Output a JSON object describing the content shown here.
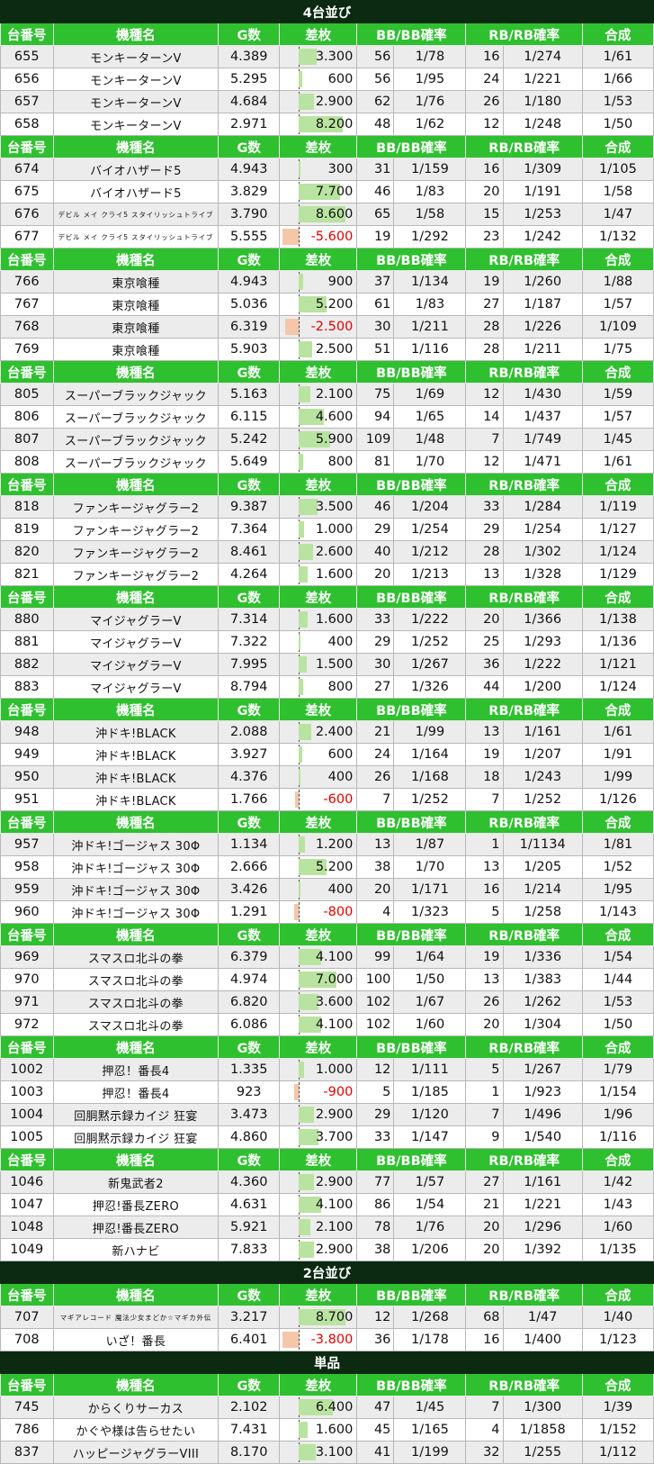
{
  "columns": [
    "台番号",
    "機種名",
    "G数",
    "差枚",
    "BB/BB確率",
    "",
    "RB/RB確率",
    "",
    "合成"
  ],
  "colors": {
    "band": "#0c2a12",
    "header": "#2fc02f",
    "plus_bar": "#b9e3a0",
    "minus_bar": "#f6c6a8",
    "minus_text": "#e00000"
  },
  "diff_scale_max": 9000,
  "blocks": [
    {
      "band": "4台並び"
    },
    {
      "rows": [
        {
          "no": "655",
          "name": "モンキーターンV",
          "g": "4.389",
          "diff": "3.300",
          "v": 3300,
          "bb": "56",
          "bbr": "1/78",
          "rb": "16",
          "rbr": "1/274",
          "total": "1/61"
        },
        {
          "no": "656",
          "name": "モンキーターンV",
          "g": "5.295",
          "diff": "600",
          "v": 600,
          "bb": "56",
          "bbr": "1/95",
          "rb": "24",
          "rbr": "1/221",
          "total": "1/66"
        },
        {
          "no": "657",
          "name": "モンキーターンV",
          "g": "4.684",
          "diff": "2.900",
          "v": 2900,
          "bb": "62",
          "bbr": "1/76",
          "rb": "26",
          "rbr": "1/180",
          "total": "1/53"
        },
        {
          "no": "658",
          "name": "モンキーターンV",
          "g": "2.971",
          "diff": "8.200",
          "v": 8200,
          "bb": "48",
          "bbr": "1/62",
          "rb": "12",
          "rbr": "1/248",
          "total": "1/50"
        }
      ]
    },
    {
      "rows": [
        {
          "no": "674",
          "name": "バイオハザード5",
          "g": "4.943",
          "diff": "300",
          "v": 300,
          "bb": "31",
          "bbr": "1/159",
          "rb": "16",
          "rbr": "1/309",
          "total": "1/105"
        },
        {
          "no": "675",
          "name": "バイオハザード5",
          "g": "3.829",
          "diff": "7.700",
          "v": 7700,
          "bb": "46",
          "bbr": "1/83",
          "rb": "20",
          "rbr": "1/191",
          "total": "1/58"
        },
        {
          "no": "676",
          "name": "デビル メイ クライ5 スタイリッシュトライブ",
          "small": true,
          "g": "3.790",
          "diff": "8.600",
          "v": 8600,
          "bb": "65",
          "bbr": "1/58",
          "rb": "15",
          "rbr": "1/253",
          "total": "1/47"
        },
        {
          "no": "677",
          "name": "デビル メイ クライ5 スタイリッシュトライブ",
          "small": true,
          "g": "5.555",
          "diff": "-5.600",
          "v": -5600,
          "bb": "19",
          "bbr": "1/292",
          "rb": "23",
          "rbr": "1/242",
          "total": "1/132"
        }
      ]
    },
    {
      "rows": [
        {
          "no": "766",
          "name": "東京喰種",
          "g": "4.943",
          "diff": "900",
          "v": 900,
          "bb": "37",
          "bbr": "1/134",
          "rb": "19",
          "rbr": "1/260",
          "total": "1/88"
        },
        {
          "no": "767",
          "name": "東京喰種",
          "g": "5.036",
          "diff": "5.200",
          "v": 5200,
          "bb": "61",
          "bbr": "1/83",
          "rb": "27",
          "rbr": "1/187",
          "total": "1/57"
        },
        {
          "no": "768",
          "name": "東京喰種",
          "g": "6.319",
          "diff": "-2.500",
          "v": -2500,
          "bb": "30",
          "bbr": "1/211",
          "rb": "28",
          "rbr": "1/226",
          "total": "1/109"
        },
        {
          "no": "769",
          "name": "東京喰種",
          "g": "5.903",
          "diff": "2.500",
          "v": 2500,
          "bb": "51",
          "bbr": "1/116",
          "rb": "28",
          "rbr": "1/211",
          "total": "1/75"
        }
      ]
    },
    {
      "rows": [
        {
          "no": "805",
          "name": "スーパーブラックジャック",
          "g": "5.163",
          "diff": "2.100",
          "v": 2100,
          "bb": "75",
          "bbr": "1/69",
          "rb": "12",
          "rbr": "1/430",
          "total": "1/59"
        },
        {
          "no": "806",
          "name": "スーパーブラックジャック",
          "g": "6.115",
          "diff": "4.600",
          "v": 4600,
          "bb": "94",
          "bbr": "1/65",
          "rb": "14",
          "rbr": "1/437",
          "total": "1/57"
        },
        {
          "no": "807",
          "name": "スーパーブラックジャック",
          "g": "5.242",
          "diff": "5.900",
          "v": 5900,
          "bb": "109",
          "bbr": "1/48",
          "rb": "7",
          "rbr": "1/749",
          "total": "1/45"
        },
        {
          "no": "808",
          "name": "スーパーブラックジャック",
          "g": "5.649",
          "diff": "800",
          "v": 800,
          "bb": "81",
          "bbr": "1/70",
          "rb": "12",
          "rbr": "1/471",
          "total": "1/61"
        }
      ]
    },
    {
      "rows": [
        {
          "no": "818",
          "name": "ファンキージャグラー2",
          "g": "9.387",
          "diff": "3.500",
          "v": 3500,
          "bb": "46",
          "bbr": "1/204",
          "rb": "33",
          "rbr": "1/284",
          "total": "1/119"
        },
        {
          "no": "819",
          "name": "ファンキージャグラー2",
          "g": "7.364",
          "diff": "1.000",
          "v": 1000,
          "bb": "29",
          "bbr": "1/254",
          "rb": "29",
          "rbr": "1/254",
          "total": "1/127"
        },
        {
          "no": "820",
          "name": "ファンキージャグラー2",
          "g": "8.461",
          "diff": "2.600",
          "v": 2600,
          "bb": "40",
          "bbr": "1/212",
          "rb": "28",
          "rbr": "1/302",
          "total": "1/124"
        },
        {
          "no": "821",
          "name": "ファンキージャグラー2",
          "g": "4.264",
          "diff": "1.600",
          "v": 1600,
          "bb": "20",
          "bbr": "1/213",
          "rb": "13",
          "rbr": "1/328",
          "total": "1/129"
        }
      ]
    },
    {
      "rows": [
        {
          "no": "880",
          "name": "マイジャグラーV",
          "g": "7.314",
          "diff": "1.600",
          "v": 1600,
          "bb": "33",
          "bbr": "1/222",
          "rb": "20",
          "rbr": "1/366",
          "total": "1/138"
        },
        {
          "no": "881",
          "name": "マイジャグラーV",
          "g": "7.322",
          "diff": "400",
          "v": 400,
          "bb": "29",
          "bbr": "1/252",
          "rb": "25",
          "rbr": "1/293",
          "total": "1/136"
        },
        {
          "no": "882",
          "name": "マイジャグラーV",
          "g": "7.995",
          "diff": "1.500",
          "v": 1500,
          "bb": "30",
          "bbr": "1/267",
          "rb": "36",
          "rbr": "1/222",
          "total": "1/121"
        },
        {
          "no": "883",
          "name": "マイジャグラーV",
          "g": "8.794",
          "diff": "800",
          "v": 800,
          "bb": "27",
          "bbr": "1/326",
          "rb": "44",
          "rbr": "1/200",
          "total": "1/124"
        }
      ]
    },
    {
      "rows": [
        {
          "no": "948",
          "name": "沖ドキ!BLACK",
          "g": "2.088",
          "diff": "2.400",
          "v": 2400,
          "bb": "21",
          "bbr": "1/99",
          "rb": "13",
          "rbr": "1/161",
          "total": "1/61"
        },
        {
          "no": "949",
          "name": "沖ドキ!BLACK",
          "g": "3.927",
          "diff": "600",
          "v": 600,
          "bb": "24",
          "bbr": "1/164",
          "rb": "19",
          "rbr": "1/207",
          "total": "1/91"
        },
        {
          "no": "950",
          "name": "沖ドキ!BLACK",
          "g": "4.376",
          "diff": "400",
          "v": 400,
          "bb": "26",
          "bbr": "1/168",
          "rb": "18",
          "rbr": "1/243",
          "total": "1/99"
        },
        {
          "no": "951",
          "name": "沖ドキ!BLACK",
          "g": "1.766",
          "diff": "-600",
          "v": -600,
          "bb": "7",
          "bbr": "1/252",
          "rb": "7",
          "rbr": "1/252",
          "total": "1/126"
        }
      ]
    },
    {
      "rows": [
        {
          "no": "957",
          "name": "沖ドキ!ゴージャス 30Φ",
          "g": "1.134",
          "diff": "1.200",
          "v": 1200,
          "bb": "13",
          "bbr": "1/87",
          "rb": "1",
          "rbr": "1/1134",
          "total": "1/81"
        },
        {
          "no": "958",
          "name": "沖ドキ!ゴージャス 30Φ",
          "g": "2.666",
          "diff": "5.200",
          "v": 5200,
          "bb": "38",
          "bbr": "1/70",
          "rb": "13",
          "rbr": "1/205",
          "total": "1/52"
        },
        {
          "no": "959",
          "name": "沖ドキ!ゴージャス 30Φ",
          "g": "3.426",
          "diff": "400",
          "v": 400,
          "bb": "20",
          "bbr": "1/171",
          "rb": "16",
          "rbr": "1/214",
          "total": "1/95"
        },
        {
          "no": "960",
          "name": "沖ドキ!ゴージャス 30Φ",
          "g": "1.291",
          "diff": "-800",
          "v": -800,
          "bb": "4",
          "bbr": "1/323",
          "rb": "5",
          "rbr": "1/258",
          "total": "1/143"
        }
      ]
    },
    {
      "rows": [
        {
          "no": "969",
          "name": "スマスロ北斗の拳",
          "g": "6.379",
          "diff": "4.100",
          "v": 4100,
          "bb": "99",
          "bbr": "1/64",
          "rb": "19",
          "rbr": "1/336",
          "total": "1/54"
        },
        {
          "no": "970",
          "name": "スマスロ北斗の拳",
          "g": "4.974",
          "diff": "7.000",
          "v": 7000,
          "bb": "100",
          "bbr": "1/50",
          "rb": "13",
          "rbr": "1/383",
          "total": "1/44"
        },
        {
          "no": "971",
          "name": "スマスロ北斗の拳",
          "g": "6.820",
          "diff": "3.600",
          "v": 3600,
          "bb": "102",
          "bbr": "1/67",
          "rb": "26",
          "rbr": "1/262",
          "total": "1/53"
        },
        {
          "no": "972",
          "name": "スマスロ北斗の拳",
          "g": "6.086",
          "diff": "4.100",
          "v": 4100,
          "bb": "102",
          "bbr": "1/60",
          "rb": "20",
          "rbr": "1/304",
          "total": "1/50"
        }
      ]
    },
    {
      "rows": [
        {
          "no": "1002",
          "name": "押忍！番長4",
          "g": "1.335",
          "diff": "1.000",
          "v": 1000,
          "bb": "12",
          "bbr": "1/111",
          "rb": "5",
          "rbr": "1/267",
          "total": "1/79"
        },
        {
          "no": "1003",
          "name": "押忍！番長4",
          "g": "923",
          "diff": "-900",
          "v": -900,
          "bb": "5",
          "bbr": "1/185",
          "rb": "1",
          "rbr": "1/923",
          "total": "1/154"
        },
        {
          "no": "1004",
          "name": "回胴黙示録カイジ 狂宴",
          "g": "3.473",
          "diff": "2.900",
          "v": 2900,
          "bb": "29",
          "bbr": "1/120",
          "rb": "7",
          "rbr": "1/496",
          "total": "1/96"
        },
        {
          "no": "1005",
          "name": "回胴黙示録カイジ 狂宴",
          "g": "4.860",
          "diff": "3.700",
          "v": 3700,
          "bb": "33",
          "bbr": "1/147",
          "rb": "9",
          "rbr": "1/540",
          "total": "1/116"
        }
      ]
    },
    {
      "rows": [
        {
          "no": "1046",
          "name": "新鬼武者2",
          "g": "4.360",
          "diff": "2.900",
          "v": 2900,
          "bb": "77",
          "bbr": "1/57",
          "rb": "27",
          "rbr": "1/161",
          "total": "1/42"
        },
        {
          "no": "1047",
          "name": "押忍!番長ZERO",
          "g": "4.631",
          "diff": "4.100",
          "v": 4100,
          "bb": "86",
          "bbr": "1/54",
          "rb": "21",
          "rbr": "1/221",
          "total": "1/43"
        },
        {
          "no": "1048",
          "name": "押忍!番長ZERO",
          "g": "5.921",
          "diff": "2.100",
          "v": 2100,
          "bb": "78",
          "bbr": "1/76",
          "rb": "20",
          "rbr": "1/296",
          "total": "1/60"
        },
        {
          "no": "1049",
          "name": "新ハナビ",
          "g": "7.833",
          "diff": "2.900",
          "v": 2900,
          "bb": "38",
          "bbr": "1/206",
          "rb": "20",
          "rbr": "1/392",
          "total": "1/135"
        }
      ]
    },
    {
      "band": "2台並び"
    },
    {
      "rows": [
        {
          "no": "707",
          "name": "マギアレコード 魔法少女まどか☆マギカ外伝",
          "small": true,
          "g": "3.217",
          "diff": "8.700",
          "v": 8700,
          "bb": "12",
          "bbr": "1/268",
          "rb": "68",
          "rbr": "1/47",
          "total": "1/40"
        },
        {
          "no": "708",
          "name": "いざ！番長",
          "g": "6.401",
          "diff": "-3.800",
          "v": -3800,
          "bb": "36",
          "bbr": "1/178",
          "rb": "16",
          "rbr": "1/400",
          "total": "1/123"
        }
      ]
    },
    {
      "band": "単品"
    },
    {
      "rows": [
        {
          "no": "745",
          "name": "からくりサーカス",
          "g": "2.102",
          "diff": "6.400",
          "v": 6400,
          "bb": "47",
          "bbr": "1/45",
          "rb": "7",
          "rbr": "1/300",
          "total": "1/39"
        },
        {
          "no": "786",
          "name": "かぐや様は告らせたい",
          "g": "7.431",
          "diff": "1.600",
          "v": 1600,
          "bb": "45",
          "bbr": "1/165",
          "rb": "4",
          "rbr": "1/1858",
          "total": "1/152"
        },
        {
          "no": "837",
          "name": "ハッピージャグラーVIII",
          "g": "8.170",
          "diff": "3.100",
          "v": 3100,
          "bb": "41",
          "bbr": "1/199",
          "rb": "32",
          "rbr": "1/255",
          "total": "1/112"
        }
      ]
    }
  ]
}
